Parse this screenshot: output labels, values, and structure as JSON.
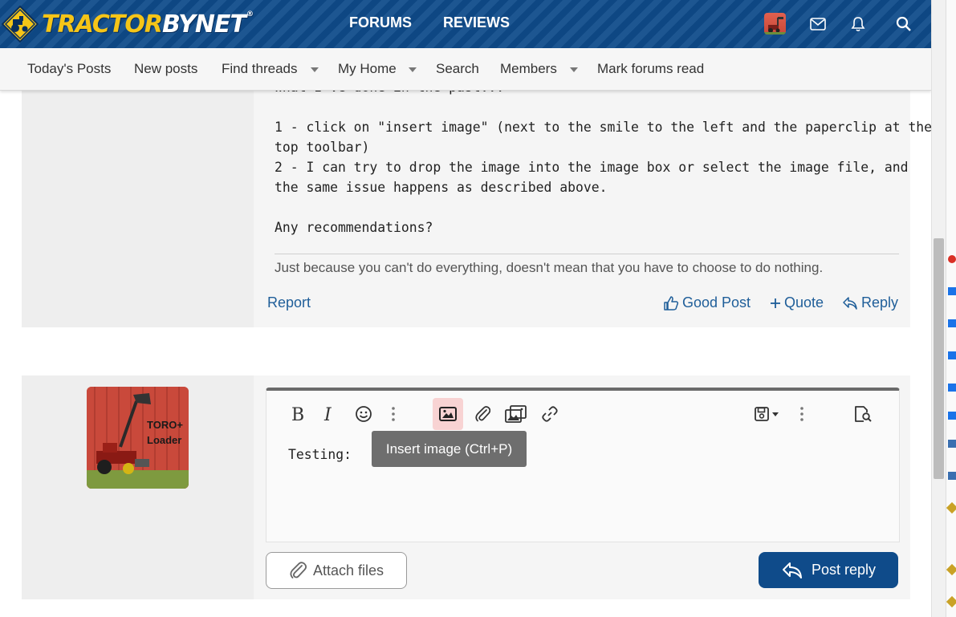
{
  "header": {
    "logo_part1": "TRACTOR",
    "logo_part2": "BYNET",
    "logo_reg": "®",
    "nav": [
      "FORUMS",
      "REVIEWS"
    ],
    "icons": [
      "avatar",
      "envelope-icon",
      "bell-icon",
      "search-icon"
    ]
  },
  "subnav": {
    "items": [
      {
        "label": "Today's Posts",
        "dropdown": false
      },
      {
        "label": "New posts",
        "dropdown": false
      },
      {
        "label": "Find threads",
        "dropdown": true
      },
      {
        "label": "My Home",
        "dropdown": true
      },
      {
        "label": "Search",
        "dropdown": false
      },
      {
        "label": "Members",
        "dropdown": true
      },
      {
        "label": "Mark forums read",
        "dropdown": false
      }
    ]
  },
  "post": {
    "partial_line": "What I've done in the past...",
    "lines": [
      "1 - click on \"insert image\" (next to the smile to the left and the paperclip at the",
      "top toolbar)",
      "2 - I can try to drop the image into the image box or select the image file, and",
      "the same issue happens as described above.",
      "",
      "Any recommendations?"
    ],
    "signature": "Just because you can't do everything, doesn't mean that you have to choose to do nothing.",
    "actions": {
      "report": "Report",
      "good_post": "Good Post",
      "quote": "Quote",
      "reply": "Reply"
    }
  },
  "reply": {
    "avatar_text_line1": "TORO+",
    "avatar_text_line2": "Loader",
    "editor_text": "Testing:",
    "tooltip": "Insert image (Ctrl+P)",
    "toolbar": [
      "bold-icon",
      "italic-icon",
      "smile-icon",
      "more-icon",
      "image-icon",
      "paperclip-icon",
      "media-icon",
      "link-icon",
      "save-draft-icon",
      "more-icon",
      "preview-icon"
    ],
    "attach_label": "Attach files",
    "post_label": "Post reply"
  },
  "colors": {
    "brand_blue": "#0f4b8a",
    "logo_yellow": "#f5c518",
    "link_blue": "#1f5e99",
    "tooltip_bg": "#6e6e6e",
    "active_tool_bg": "#f8d3d3"
  }
}
